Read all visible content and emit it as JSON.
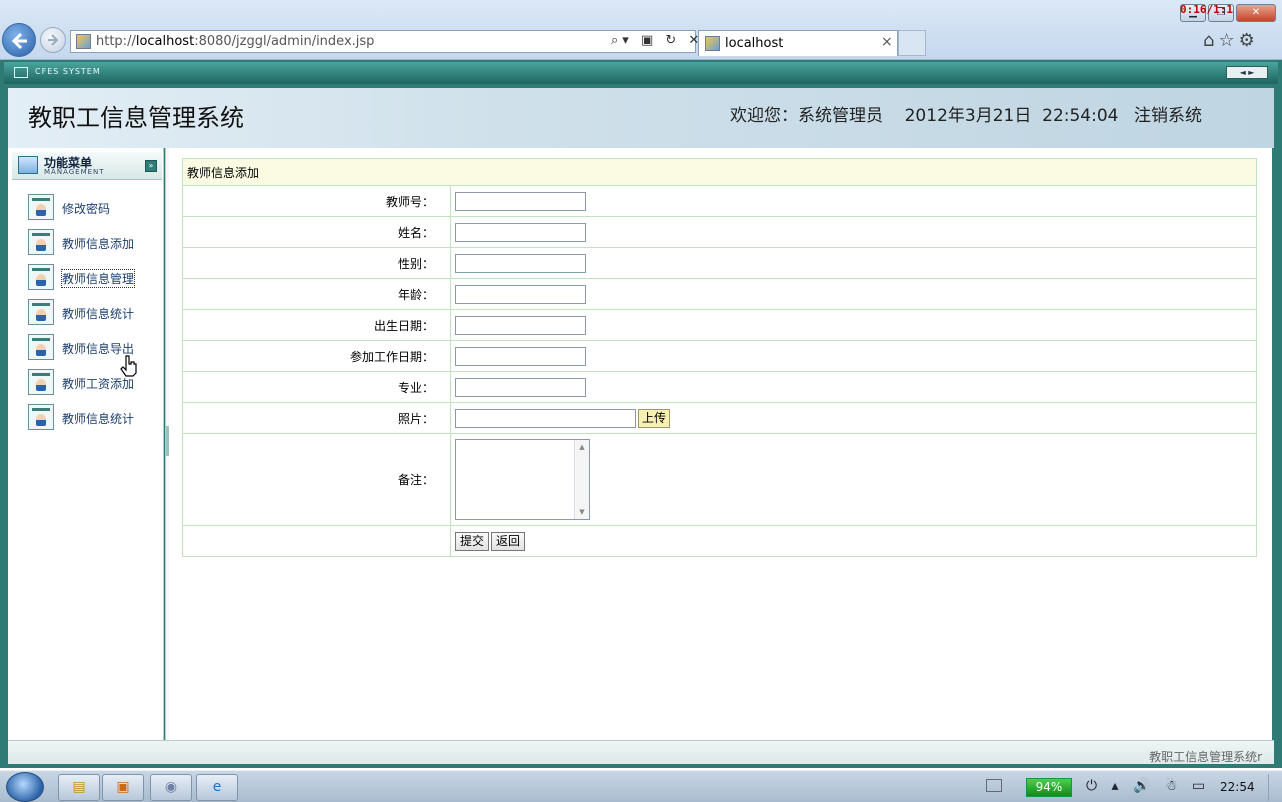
{
  "browser": {
    "recording_indicator": "0:16/1:1",
    "window_buttons": {
      "minimize": "▁",
      "maximize": "❐",
      "close": "✕"
    },
    "address": {
      "url_prefix": "http://",
      "url_host": "localhost",
      "url_rest": ":8080/jzggl/admin/index.jsp"
    },
    "address_icons": "⌕▾ ▣ ↻ ✕",
    "tab": {
      "title": "localhost",
      "close": "×"
    },
    "toolbar_icons": {
      "home": "⌂",
      "favorites": "☆",
      "tools": "⚙"
    }
  },
  "app": {
    "system_label": "CFES SYSTEM",
    "strip_arrows": "◄ ►",
    "title": "教职工信息管理系统",
    "welcome": "欢迎您：系统管理员    2012年3月21日  22:54:04",
    "logout": "注销系统",
    "status_text": "教职工信息管理系统r"
  },
  "sidebar": {
    "header_title": "功能菜单",
    "header_sub": "MANAGEMENT",
    "collapse": "»",
    "items": [
      {
        "label": "修改密码"
      },
      {
        "label": "教师信息添加"
      },
      {
        "label": "教师信息管理"
      },
      {
        "label": "教师信息统计"
      },
      {
        "label": "教师信息导出"
      },
      {
        "label": "教师工资添加"
      },
      {
        "label": "教师信息统计"
      }
    ]
  },
  "form": {
    "caption": "教师信息添加",
    "labels": {
      "teacher_no": "教师号：",
      "name": "姓名：",
      "gender": "性别：",
      "age": "年龄：",
      "birth_date": "出生日期：",
      "work_start_date": "参加工作日期：",
      "major": "专业：",
      "photo": "照片：",
      "remark": "备注："
    },
    "values": {
      "teacher_no": "",
      "name": "",
      "gender": "",
      "age": "",
      "birth_date": "",
      "work_start_date": "",
      "major": "",
      "photo": "",
      "remark": ""
    },
    "upload_button": "上传",
    "submit_button": "提交",
    "back_button": "返回"
  },
  "taskbar": {
    "battery": "94%",
    "clock": "22:54",
    "tray_icons": "⏻ ▴ 🔊 ☃ ▭"
  },
  "colors": {
    "app_frame": "#2e7a75",
    "banner": "#cfe0ea",
    "caption_bg": "#fafbe2",
    "table_border": "#c2e3bf",
    "menu_text": "#1c3f6e"
  }
}
